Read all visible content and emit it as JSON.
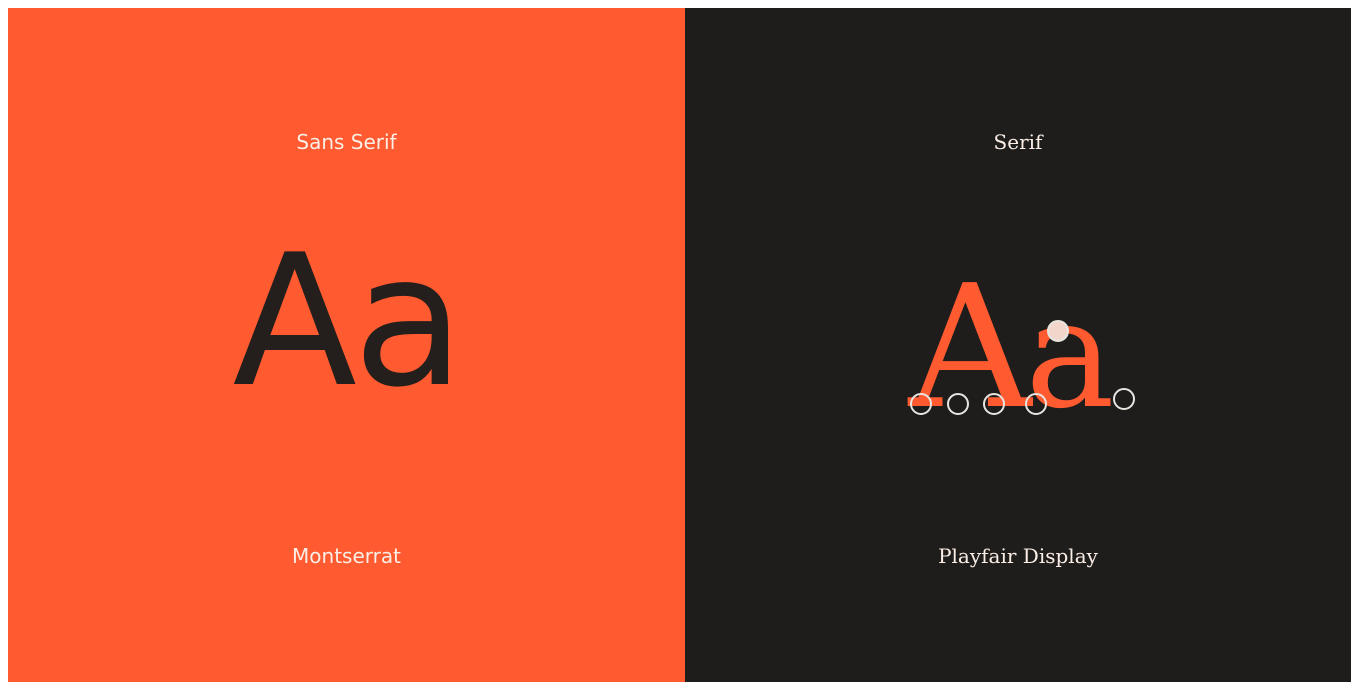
{
  "colors": {
    "left_background": "#ff5a30",
    "right_background": "#1e1d1b",
    "label_text": "#fbeee6",
    "sans_glyph": "#241f1c",
    "serif_glyph": "#ff5a30",
    "marker_stroke": "#e8e4e0"
  },
  "left_panel": {
    "category": "Sans Serif",
    "specimen": "Aa",
    "font_name": "Montserrat"
  },
  "right_panel": {
    "category": "Serif",
    "specimen_A": "A",
    "specimen_a": "a",
    "font_name": "Playfair Display"
  }
}
